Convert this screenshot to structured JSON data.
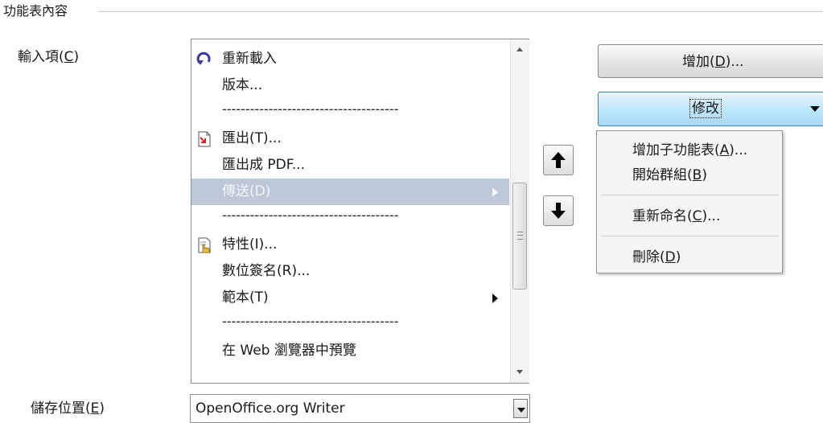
{
  "group_title": "功能表內容",
  "entries_label": {
    "text": "輸入項(",
    "mnemonic": "C",
    "suffix": ")"
  },
  "entries": [
    {
      "label": "重新載入",
      "icon": "reload-icon"
    },
    {
      "label": "版本..."
    },
    {
      "label": "--------------------------------------",
      "separator": true
    },
    {
      "label": "匯出(T)...",
      "icon": "export-icon"
    },
    {
      "label": "匯出成 PDF..."
    },
    {
      "label": "傳送(D)",
      "submenu": true,
      "selected": true
    },
    {
      "label": "--------------------------------------",
      "separator": true
    },
    {
      "label": "特性(I)...",
      "icon": "properties-icon"
    },
    {
      "label": "數位簽名(R)..."
    },
    {
      "label": "範本(T)",
      "submenu": true
    },
    {
      "label": "--------------------------------------",
      "separator": true
    },
    {
      "label": "在 Web 瀏覽器中預覽"
    }
  ],
  "buttons": {
    "add": {
      "text": "增加(",
      "mnemonic": "D",
      "suffix": ")..."
    },
    "modify": {
      "text": "修改"
    }
  },
  "modify_menu": {
    "items": [
      {
        "text": "增加子功能表(",
        "mnemonic": "A",
        "suffix": ")..."
      },
      {
        "text": "開始群組(",
        "mnemonic": "B",
        "suffix": ")"
      },
      {
        "text": "重新命名(",
        "mnemonic": "C",
        "suffix": ")..."
      },
      {
        "text": "刪除(",
        "mnemonic": "D",
        "suffix": ")"
      }
    ]
  },
  "save_location": {
    "label": {
      "text": "儲存位置(",
      "mnemonic": "E",
      "suffix": ")"
    },
    "value": "OpenOffice.org Writer"
  },
  "colors": {
    "selection": "#bcc7d8",
    "modify_button": "#bee6fd"
  }
}
